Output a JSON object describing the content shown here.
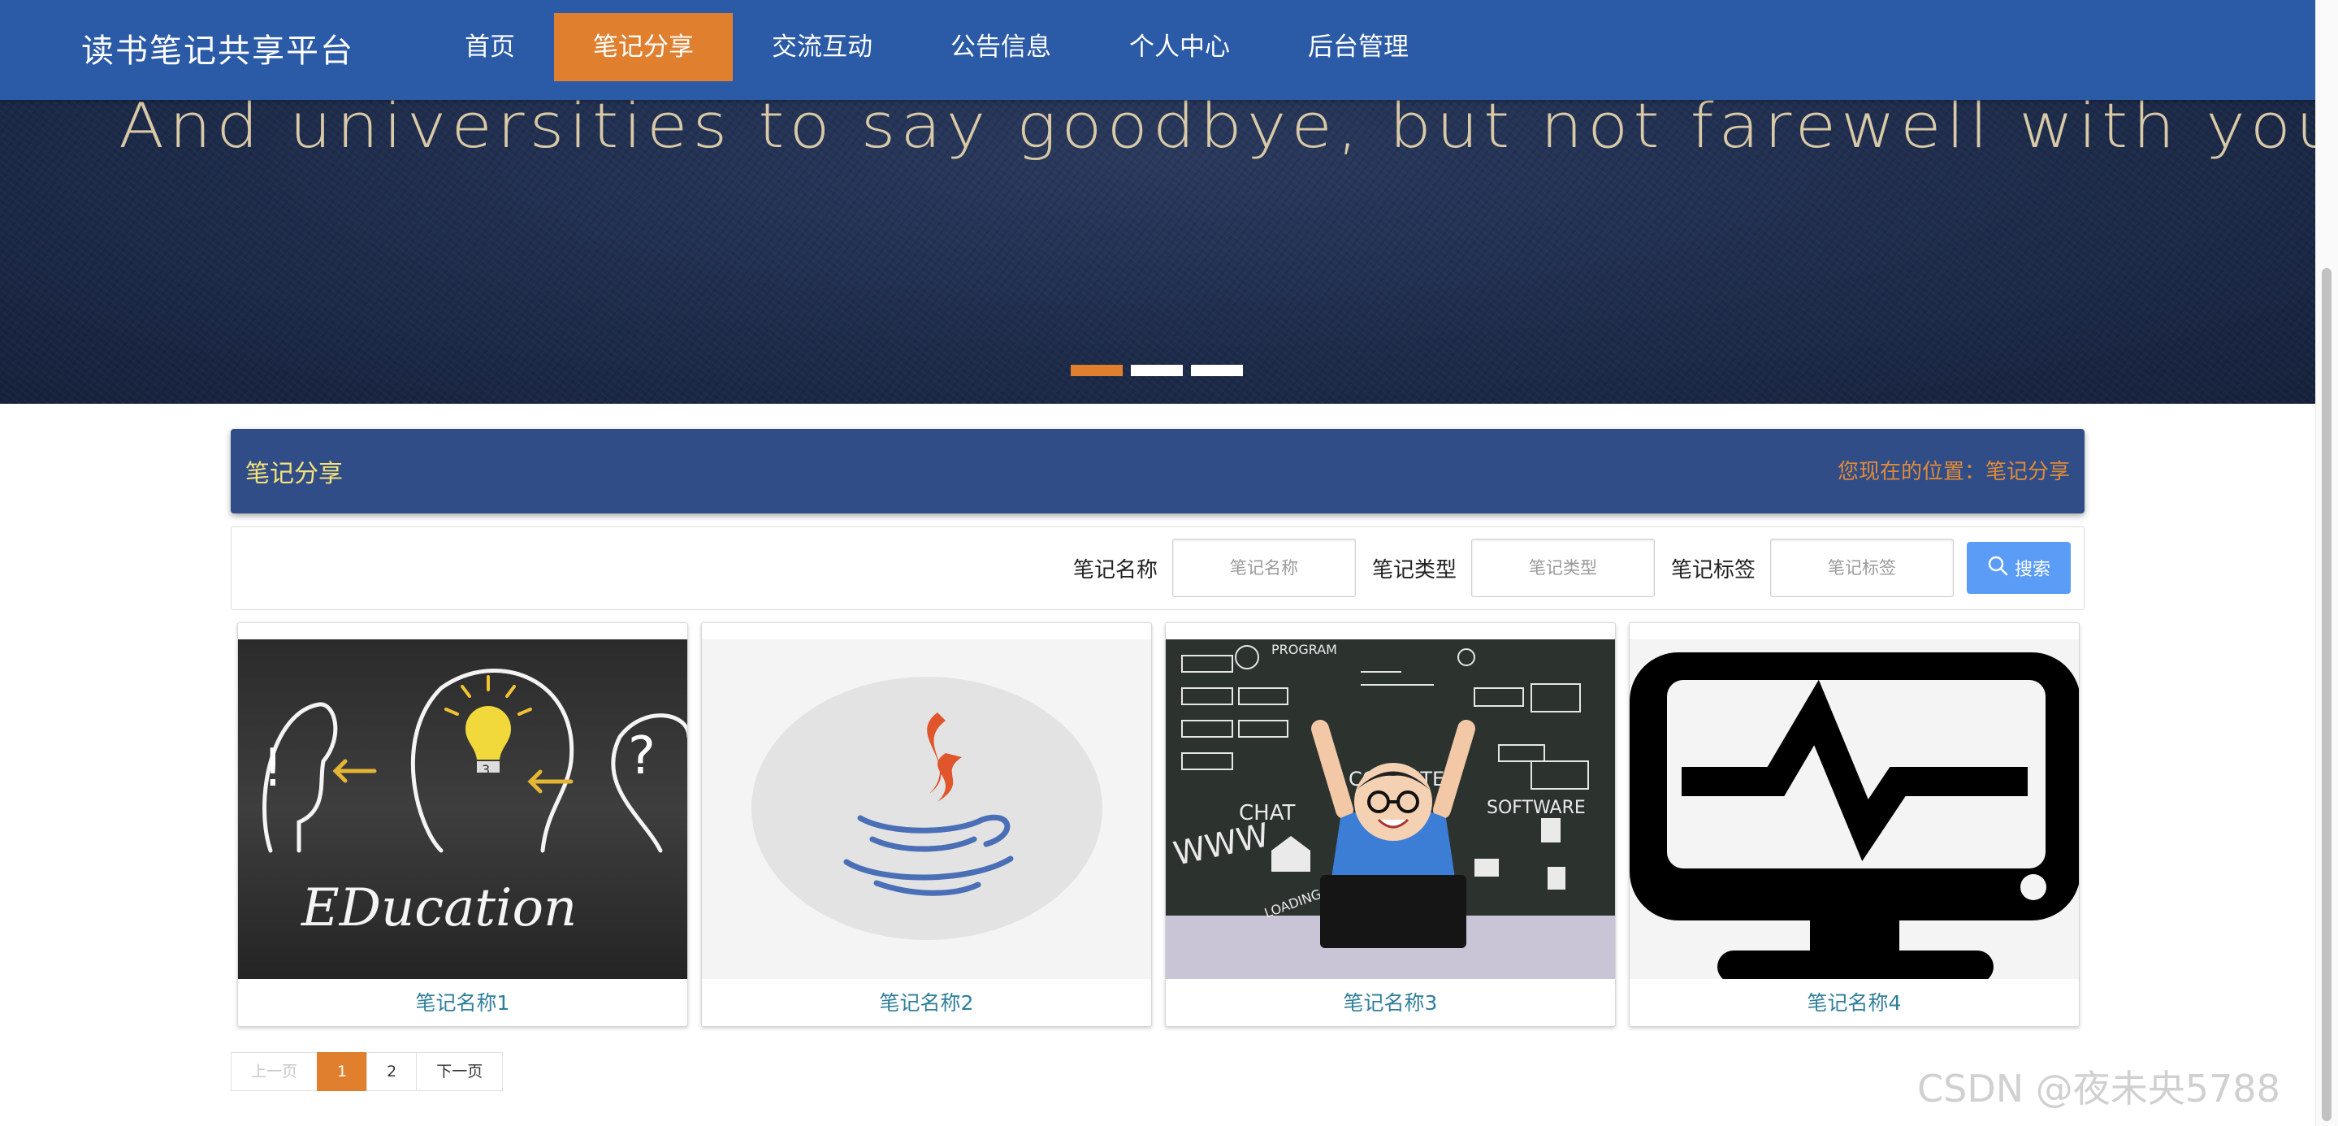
{
  "brand": "读书笔记共享平台",
  "nav": [
    {
      "label": "首页",
      "active": false
    },
    {
      "label": "笔记分享",
      "active": true
    },
    {
      "label": "交流互动",
      "active": false
    },
    {
      "label": "公告信息",
      "active": false
    },
    {
      "label": "个人中心",
      "active": false
    },
    {
      "label": "后台管理",
      "active": false
    }
  ],
  "banner": {
    "text": "And universities to say goodbye, but not farewell with youth",
    "slides": 3,
    "active_slide": 1
  },
  "section": {
    "title": "笔记分享",
    "location": "您现在的位置：笔记分享"
  },
  "search": {
    "fields": [
      {
        "label": "笔记名称",
        "placeholder": "笔记名称"
      },
      {
        "label": "笔记类型",
        "placeholder": "笔记类型"
      },
      {
        "label": "笔记标签",
        "placeholder": "笔记标签"
      }
    ],
    "button_label": "搜索"
  },
  "cards": [
    {
      "title": "笔记名称1",
      "image": "education-chalkboard-image",
      "image_text": "EDucation"
    },
    {
      "title": "笔记名称2",
      "image": "java-logo-image"
    },
    {
      "title": "笔记名称3",
      "image": "child-computer-chalkboard-image",
      "image_text": [
        "PROGRAM",
        "CHAT",
        "WWW",
        "COMPUTER",
        "SOFTWARE",
        "LOADING"
      ]
    },
    {
      "title": "笔记名称4",
      "image": "monitor-heartbeat-icon"
    }
  ],
  "pagination": {
    "prev": "上一页",
    "pages": [
      "1",
      "2"
    ],
    "current": "1",
    "next": "下一页"
  },
  "watermark": "CSDN @夜未央5788",
  "colors": {
    "navbar": "#2b5aa7",
    "accent": "#e07f2d",
    "section_header": "#314d88",
    "section_title": "#f7e27a",
    "search_button": "#5b9cf6",
    "card_title": "#2f7e9c"
  }
}
